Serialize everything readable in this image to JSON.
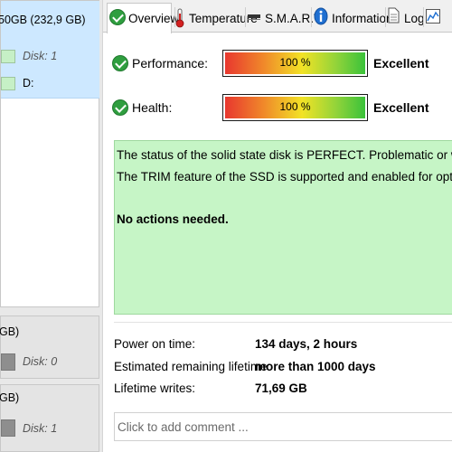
{
  "left_panel": {
    "disk1": {
      "title": "50GB (232,9 GB)",
      "volumes": [
        {
          "label": "Disk: 1",
          "style": "italic",
          "color": "#c6f0c6"
        },
        {
          "label": "D:",
          "style": "normal",
          "color": "#c6f0c6"
        }
      ]
    },
    "disk2": {
      "title": "GB)",
      "volume_label": "Disk: 0"
    },
    "disk3": {
      "title": "GB)",
      "volume_label": "Disk: 1"
    }
  },
  "tabs": [
    {
      "label": "Overview",
      "icon": "check-circle-icon",
      "active": true
    },
    {
      "label": "Temperature",
      "icon": "thermometer-icon",
      "active": false
    },
    {
      "label": "S.M.A.R.T.",
      "icon": "smart-table-icon",
      "active": false
    },
    {
      "label": "Information",
      "icon": "info-icon",
      "active": false
    },
    {
      "label": "Log",
      "icon": "log-document-icon",
      "active": false
    },
    {
      "label": "",
      "icon": "chart-icon",
      "active": false
    }
  ],
  "metrics": [
    {
      "label": "Performance:",
      "value_text": "100 %",
      "value": 100,
      "rating": "Excellent"
    },
    {
      "label": "Health:",
      "value_text": "100 %",
      "value": 100,
      "rating": "Excellent"
    }
  ],
  "status": {
    "line1": "The status of the solid state disk is PERFECT. Problematic or weak sectors were n",
    "line2": "The TRIM feature of the SSD is supported and enabled for optimal performance.",
    "line3": "No actions needed.",
    "color": "#c6f5c6"
  },
  "facts": [
    {
      "label": "Power on time:",
      "value": "134 days, 2 hours"
    },
    {
      "label": "Estimated remaining lifetime:",
      "value": "more than 1000 days"
    },
    {
      "label": "Lifetime writes:",
      "value": "71,69 GB"
    }
  ],
  "comment": {
    "placeholder": "Click to add comment ..."
  },
  "colors": {
    "selection": "#cde8ff",
    "ok_green": "#2f9e3f"
  }
}
